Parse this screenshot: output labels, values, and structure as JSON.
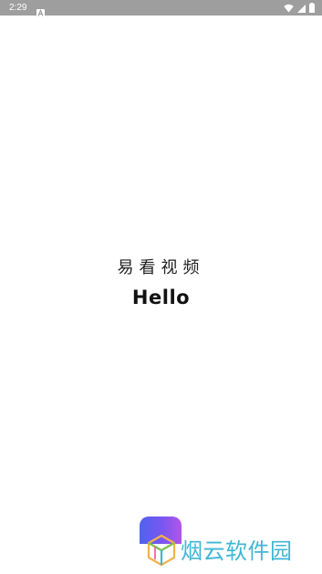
{
  "status_bar": {
    "time": "2:29",
    "bg_color": "#9e9e9e",
    "icons": [
      "notification-a-icon",
      "wifi-icon",
      "signal-icon",
      "battery-icon"
    ]
  },
  "splash": {
    "app_name": "易看视频",
    "greeting": "Hello",
    "logo_gradient": [
      "#4f63f0",
      "#b455e8"
    ]
  },
  "watermark": {
    "text": "烟云软件园",
    "color": "#3fb6d6"
  }
}
